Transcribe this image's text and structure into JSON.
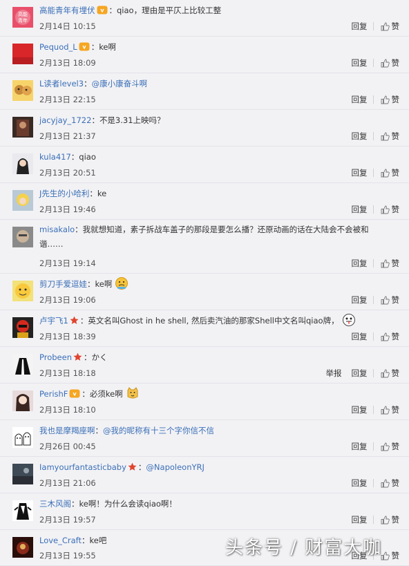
{
  "actions": {
    "reply": "回复",
    "like": "赞",
    "report": "举报"
  },
  "comments": [
    {
      "user": "高能青年有埋伏",
      "badge": "vip",
      "segments": [
        {
          "t": "text",
          "v": "qiao，理由是平仄上比较工整"
        }
      ],
      "date": "2月14日 10:15",
      "avatar": "blue-logo"
    },
    {
      "user": "Pequod_L",
      "badge": "vip",
      "segments": [
        {
          "t": "text",
          "v": "ke啊"
        }
      ],
      "date": "2月13日 18:09",
      "avatar": "red"
    },
    {
      "user": "L读者level3",
      "badge": "",
      "segments": [
        {
          "t": "mention",
          "v": "@康小康奋斗啊"
        }
      ],
      "date": "2月13日 22:15",
      "avatar": "dog"
    },
    {
      "user": "jacyjay_1722",
      "badge": "",
      "segments": [
        {
          "t": "text",
          "v": "不是3.31上映吗？"
        }
      ],
      "date": "2月13日 21:37",
      "avatar": "dark"
    },
    {
      "user": "kula417",
      "badge": "",
      "segments": [
        {
          "t": "text",
          "v": "qiao"
        }
      ],
      "date": "2月13日 20:51",
      "avatar": "anime-dark"
    },
    {
      "user": "J先生的小哈利",
      "badge": "",
      "segments": [
        {
          "t": "text",
          "v": "ke"
        }
      ],
      "date": "2月13日 19:46",
      "avatar": "blonde"
    },
    {
      "user": "misakalo",
      "badge": "",
      "segments": [
        {
          "t": "text",
          "v": "我就想知道，素子拆战车盖子的那段是要怎么播？还原动画的话在大陆会不会被和谐……"
        }
      ],
      "date": "2月13日 19:14",
      "avatar": "face",
      "wrap": true
    },
    {
      "user": "剪刀手爱逗娃",
      "badge": "",
      "segments": [
        {
          "t": "text",
          "v": "ke啊"
        },
        {
          "t": "emoji",
          "v": "face"
        }
      ],
      "date": "2月13日 19:06",
      "avatar": "yellow"
    },
    {
      "user": "卢宇飞1",
      "badge": "star",
      "segments": [
        {
          "t": "text",
          "v": "英文名叫Ghost in he shell, 然后卖汽油的那家Shell中文名叫qiao牌，"
        },
        {
          "t": "emoji",
          "v": "tongue"
        }
      ],
      "date": "2月13日 18:39",
      "avatar": "robot"
    },
    {
      "user": "Probeen",
      "badge": "star",
      "segments": [
        {
          "t": "text",
          "v": "かく"
        }
      ],
      "date": "2月13日 18:18",
      "avatar": "suit",
      "report": true
    },
    {
      "user": "PerishF",
      "badge": "vip",
      "segments": [
        {
          "t": "text",
          "v": "必须ke啊"
        },
        {
          "t": "emoji",
          "v": "cat"
        }
      ],
      "date": "2月13日 18:10",
      "avatar": "girl"
    },
    {
      "user": "我也是摩羯座啊",
      "badge": "",
      "segments": [
        {
          "t": "mention",
          "v": "@我的昵称有十三个字你信不信"
        }
      ],
      "date": "2月26日 00:45",
      "avatar": "ghosts"
    },
    {
      "user": "Iamyourfantasticbaby",
      "badge": "star",
      "segments": [
        {
          "t": "mention",
          "v": "@NapoleonYRJ"
        }
      ],
      "date": "2月13日 21:06",
      "avatar": "scene"
    },
    {
      "user": "三木风阁",
      "badge": "",
      "segments": [
        {
          "t": "text",
          "v": "ke啊！为什么会读qiao啊！"
        }
      ],
      "date": "2月13日 19:57",
      "avatar": "sketch"
    },
    {
      "user": "Love_Craft",
      "badge": "",
      "segments": [
        {
          "t": "text",
          "v": "ke吧"
        }
      ],
      "date": "2月13日 19:55",
      "avatar": "redscene"
    }
  ],
  "watermark": "头条号 / 财富大咖",
  "colors": {
    "background": "#f2f2f5",
    "username": "#3b6fb6",
    "star": "#e0452f",
    "vip": "#f6a623"
  }
}
